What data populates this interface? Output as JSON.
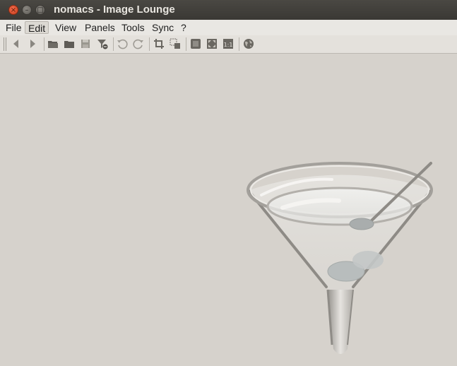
{
  "window": {
    "title": "nomacs - Image Lounge",
    "controls": {
      "close": "×",
      "minimize": "–",
      "maximize": "□"
    }
  },
  "menu": {
    "items": [
      "File",
      "Edit",
      "View",
      "Panels",
      "Tools",
      "Sync",
      "?"
    ],
    "active": "Edit"
  },
  "toolbar": {
    "icons": [
      "previous-icon",
      "next-icon",
      "open-icon",
      "open-dir-icon",
      "save-icon",
      "filter-icon",
      "rotate-ccw-icon",
      "rotate-cw-icon",
      "crop-icon",
      "resize-icon",
      "fullscreen-icon",
      "fit-icon",
      "actual-size-icon",
      "web-icon"
    ]
  },
  "colors": {
    "titlebar": "#3c3b37",
    "background": "#d6d2cc",
    "icon": "#6d6a64",
    "close_button": "#e0502e"
  }
}
